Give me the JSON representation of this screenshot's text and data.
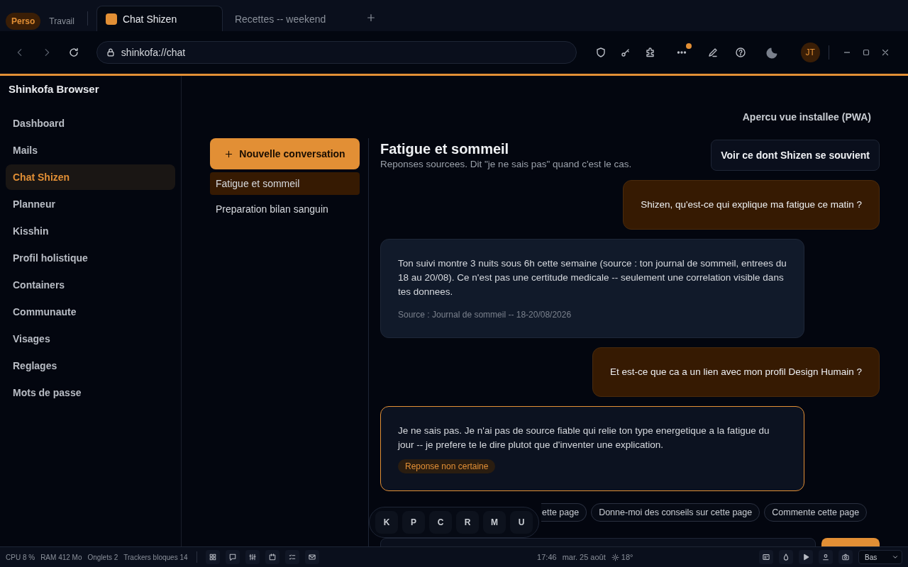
{
  "tab_groups": [
    {
      "label": "Perso",
      "selected": true
    },
    {
      "label": "Travail",
      "selected": false
    }
  ],
  "tabs": [
    {
      "title": "Chat Shizen",
      "selected": true
    },
    {
      "title": "Recettes -- weekend",
      "selected": false
    }
  ],
  "address_bar": {
    "url": "shinkofa://chat"
  },
  "toolbar": {
    "more_badge": true,
    "avatar": "JT"
  },
  "sidebar": {
    "title": "Shinkofa Browser",
    "items": [
      {
        "label": "Dashboard",
        "selected": false
      },
      {
        "label": "Mails",
        "selected": false
      },
      {
        "label": "Chat Shizen",
        "selected": true
      },
      {
        "label": "Planneur",
        "selected": false
      },
      {
        "label": "Kisshin",
        "selected": false
      },
      {
        "label": "Profil holistique",
        "selected": false
      },
      {
        "label": "Containers",
        "selected": false
      },
      {
        "label": "Communaute",
        "selected": false
      },
      {
        "label": "Visages",
        "selected": false
      },
      {
        "label": "Reglages",
        "selected": false
      },
      {
        "label": "Mots de passe",
        "selected": false
      }
    ]
  },
  "pwa_link": "Apercu vue installee (PWA)",
  "conversations": {
    "new_button": "Nouvelle conversation",
    "items": [
      {
        "title": "Fatigue et sommeil",
        "selected": true
      },
      {
        "title": "Preparation bilan sanguin",
        "selected": false
      }
    ]
  },
  "chat": {
    "title": "Fatigue et sommeil",
    "subtitle": "Reponses sourcees. Dit \"je ne sais pas\" quand c'est le cas.",
    "memory_button": "Voir ce dont Shizen se souvient",
    "messages": [
      {
        "kind": "user",
        "text": "Shizen, qu'est-ce qui explique ma fatigue ce matin ?"
      },
      {
        "kind": "answer",
        "text": "Ton suivi montre 3 nuits sous 6h cette semaine (source : ton journal de sommeil, entrees du 18 au 20/08). Ce n'est pas une certitude medicale -- seulement une correlation visible dans tes donnees.",
        "source": "Source : Journal de sommeil -- 18-20/08/2026"
      },
      {
        "kind": "user",
        "text": "Et est-ce que ca a un lien avec mon profil Design Humain ?"
      },
      {
        "kind": "uncertain",
        "text": "Je ne sais pas. Je n'ai pas de source fiable qui relie ton type energetique a la fatigue du jour -- je prefere te le dire plutot que d'inventer une explication.",
        "badge": "Reponse non certaine"
      }
    ],
    "suggestions": [
      "ette page",
      "Donne-moi des conseils sur cette page",
      "Commente cette page"
    ]
  },
  "dock": [
    "K",
    "P",
    "C",
    "R",
    "M",
    "U"
  ],
  "status_bar": {
    "stats": [
      "CPU 8 %",
      "RAM 412 Mo",
      "Onglets 2",
      "Trackers bloques 14"
    ],
    "time": "17:46",
    "date": "mar. 25 août",
    "weather": "18°",
    "position": "Bas"
  }
}
